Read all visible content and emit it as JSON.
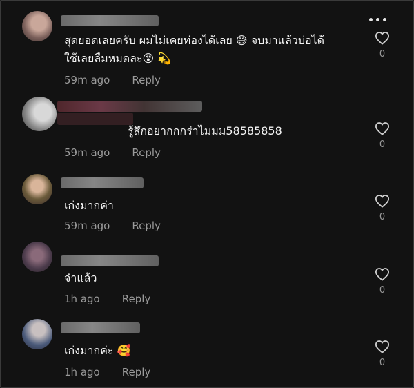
{
  "comments": [
    {
      "text_line1": "สุดยอดเลยครับ ผมไม่เคยท่องได้เลย 😅 จบมาแล้วบ่อได้",
      "text_line2": "ใช้เลยลืมหมดละ😵 💫",
      "time": "59m ago",
      "reply": "Reply",
      "likes": "0"
    },
    {
      "text_line1": "รู้สึกอยากกกร่าไมมม58585858",
      "time": "59m ago",
      "reply": "Reply",
      "likes": "0"
    },
    {
      "text_line1": "เก่งมากค่า",
      "time": "59m ago",
      "reply": "Reply",
      "likes": "0"
    },
    {
      "text_line1": "จำแล้ว",
      "time": "1h ago",
      "reply": "Reply",
      "likes": "0"
    },
    {
      "text_line1": "เก่งมากค่ะ 🥰",
      "time": "1h ago",
      "reply": "Reply",
      "likes": "0"
    }
  ],
  "colors": {
    "background": "#121212",
    "text": "#f2f2f2",
    "muted": "#9a9a9a"
  },
  "icons": {
    "like": "heart-outline-icon",
    "more": "more-dots-icon"
  }
}
